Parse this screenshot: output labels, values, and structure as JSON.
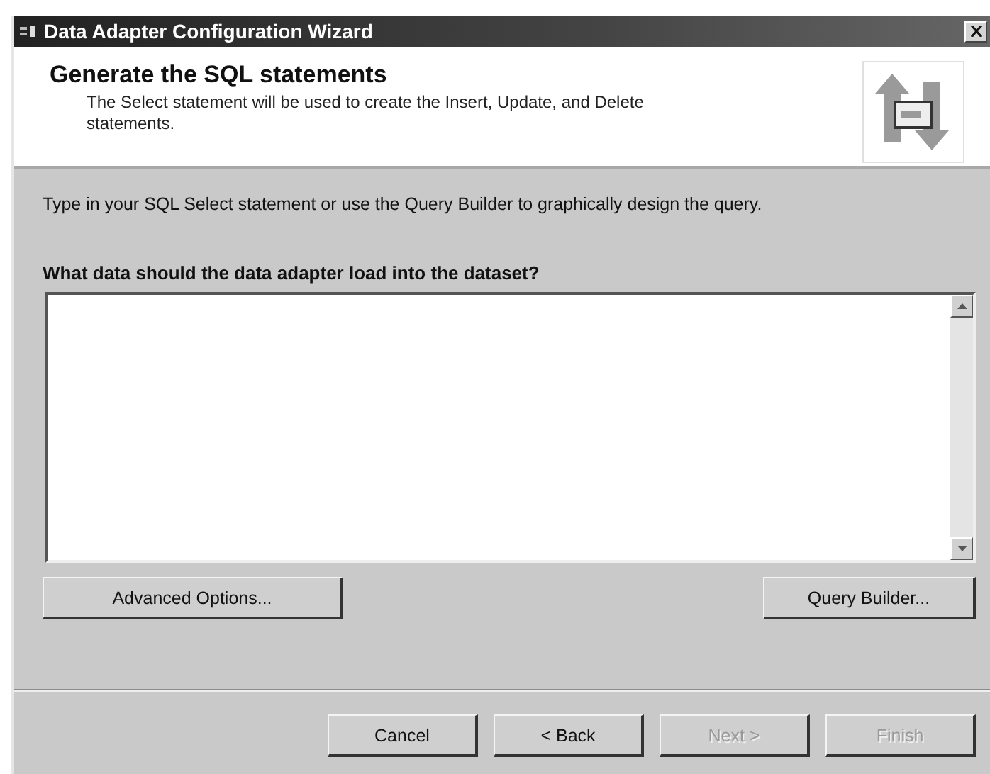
{
  "window": {
    "title": "Data Adapter Configuration Wizard"
  },
  "header": {
    "title": "Generate the SQL statements",
    "subtitle": "The Select statement will be used to create the Insert, Update, and Delete statements."
  },
  "instruction": "Type in your SQL Select statement or use the Query Builder to graphically design the query.",
  "query": {
    "label": "What data should the data adapter load into the dataset?"
  },
  "action_buttons": [
    {
      "label": "Advanced Options..."
    },
    {
      "label": "Query Builder..."
    }
  ],
  "nav_buttons": [
    {
      "label": "Cancel",
      "disabled": false
    },
    {
      "label": "< Back",
      "disabled": false
    },
    {
      "label": "Next >",
      "disabled": true
    },
    {
      "label": "Finish",
      "disabled": true
    }
  ]
}
